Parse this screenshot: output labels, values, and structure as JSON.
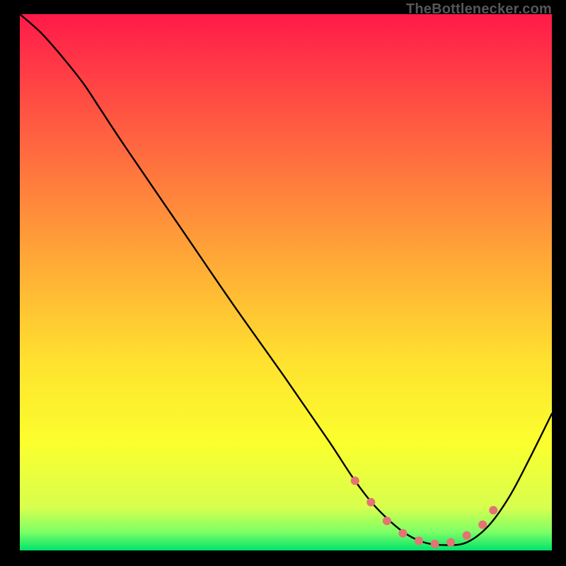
{
  "watermark": "TheBottlenecker.com",
  "chart_data": {
    "type": "line",
    "title": "",
    "xlabel": "",
    "ylabel": "",
    "xlim": [
      0,
      100
    ],
    "ylim": [
      0,
      100
    ],
    "gradient_stops": [
      {
        "offset": 0,
        "color": "#ff1a49"
      },
      {
        "offset": 0.2,
        "color": "#ff5942"
      },
      {
        "offset": 0.45,
        "color": "#ffa637"
      },
      {
        "offset": 0.65,
        "color": "#ffe22f"
      },
      {
        "offset": 0.8,
        "color": "#fbff2e"
      },
      {
        "offset": 0.92,
        "color": "#d7ff4e"
      },
      {
        "offset": 0.965,
        "color": "#7fff66"
      },
      {
        "offset": 1.0,
        "color": "#00e36b"
      }
    ],
    "series": [
      {
        "name": "bottleneck-curve",
        "x": [
          0,
          4,
          8,
          12,
          15,
          20,
          30,
          40,
          50,
          58,
          63,
          67,
          72,
          76,
          80,
          84,
          88,
          92,
          96,
          100
        ],
        "y": [
          100,
          96.5,
          92,
          87,
          82.5,
          75,
          60.5,
          46,
          32,
          20.5,
          13,
          8,
          3.5,
          1.5,
          1,
          1.5,
          4.5,
          10,
          17.5,
          25.5
        ]
      }
    ],
    "markers": {
      "name": "optimal-range-dots",
      "color": "#e57373",
      "radius": 6,
      "x": [
        63,
        66,
        69,
        72,
        75,
        78,
        81,
        84,
        87,
        89
      ],
      "y": [
        13,
        9,
        5.5,
        3.2,
        1.8,
        1.2,
        1.5,
        2.8,
        4.8,
        7.5
      ]
    }
  }
}
